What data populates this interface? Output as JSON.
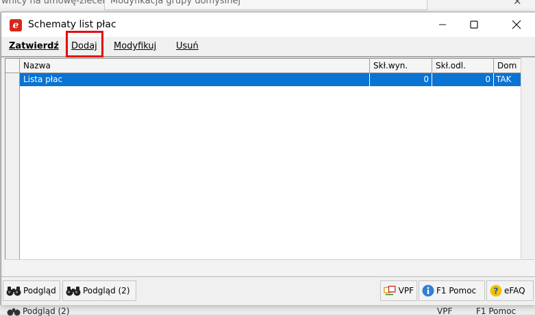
{
  "background": {
    "partial_text_left": "wnicy na umowę-zlecen",
    "partial_text_window": "Modyfikacja grupy domyślnej",
    "bottom_button": "Podgląd (2)",
    "bottom_right_1": "VPF",
    "bottom_right_2": "F1 Pomoc"
  },
  "window": {
    "title": "Schematy list płac",
    "icon": "app-logo-icon",
    "controls": [
      "minimize",
      "maximize",
      "close"
    ]
  },
  "menu": {
    "items": [
      {
        "label": "Zatwierdź",
        "bold": true
      },
      {
        "label": "Dodaj",
        "highlighted": true
      },
      {
        "label": "Modyfikuj"
      },
      {
        "label": "Usuń"
      }
    ]
  },
  "grid": {
    "columns": [
      "Nazwa",
      "Skł.wyn.",
      "Skł.odl.",
      "Dom"
    ],
    "rows": [
      {
        "nazwa": "Lista płac",
        "skl_wyn": "0",
        "skl_odl": "0",
        "dom": "TAK",
        "selected": true
      }
    ]
  },
  "statusbar": {
    "buttons": [
      {
        "label": "Podgląd",
        "icon": "binoculars-icon"
      },
      {
        "label": "Podgląd (2)",
        "icon": "binoculars-icon"
      },
      {
        "label": "VPF",
        "icon": "vpf-icon"
      },
      {
        "label": "F1 Pomoc",
        "icon": "info-icon"
      },
      {
        "label": "eFAQ",
        "icon": "question-icon"
      }
    ]
  },
  "colors": {
    "selection": "#0a73d4",
    "highlight_box": "#e8000b",
    "app_icon": "#d9261c"
  }
}
